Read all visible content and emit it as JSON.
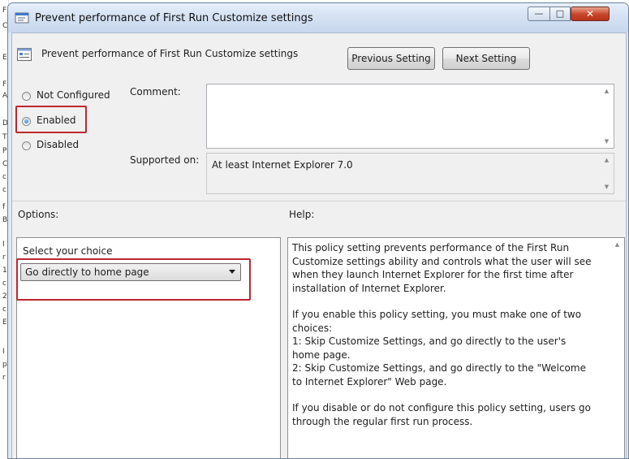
{
  "background_text": [
    "F",
    "C",
    "E",
    "F",
    "A",
    "D",
    "T",
    "P",
    "C",
    "c",
    "c",
    "f",
    "B",
    "I",
    "r",
    "1",
    "c",
    "2",
    "c",
    "E",
    "I",
    "p",
    "r"
  ],
  "window": {
    "title": "Prevent performance of First Run Customize settings",
    "controls": {
      "minimize": "—",
      "maximize": "□",
      "close": "✕"
    }
  },
  "policy": {
    "title": "Prevent performance of First Run Customize settings",
    "prev_button": "Previous Setting",
    "next_button": "Next Setting"
  },
  "state": {
    "options": [
      "Not Configured",
      "Enabled",
      "Disabled"
    ],
    "selected": "Enabled"
  },
  "comment": {
    "label": "Comment:",
    "value": ""
  },
  "supported": {
    "label": "Supported on:",
    "value": "At least Internet Explorer 7.0"
  },
  "options_panel": {
    "label": "Options:",
    "choice_label": "Select your choice",
    "selected_choice": "Go directly to home page"
  },
  "help": {
    "label": "Help:",
    "paragraphs": [
      "This policy setting prevents performance of the First Run Customize settings ability and controls what the user will see when they launch Internet Explorer for the first time after installation of Internet Explorer.",
      "If you enable this policy setting, you must make one of two choices:",
      "1: Skip Customize Settings, and go directly to the user's home page.",
      "2: Skip Customize Settings, and go directly to the \"Welcome to Internet Explorer\" Web page.",
      "If you disable or do not configure this policy setting, users go through the regular first run process."
    ]
  },
  "colors": {
    "highlight": "#c0262d",
    "title_bar": "#d5e2f3",
    "dialog_bg": "#f0f0f0"
  },
  "icons": {
    "window": "policy-window-icon",
    "policy": "policy-setting-icon"
  }
}
